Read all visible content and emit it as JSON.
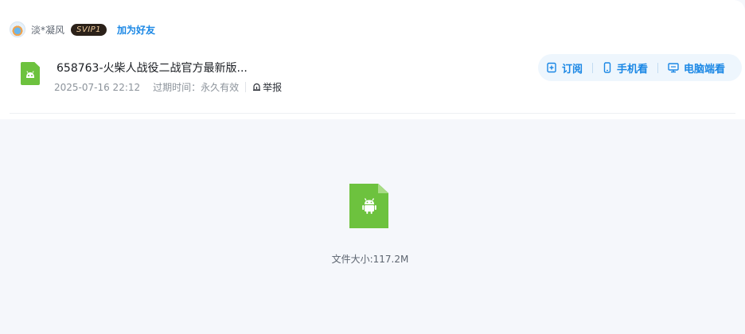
{
  "header": {
    "username": "淡*凝风",
    "badge": "SVIP1",
    "add_friend": "加为好友"
  },
  "file": {
    "title": "658763-火柴人战役二战官方最新版...",
    "date": "2025-07-16 22:12",
    "expiry": "过期时间：永久有效",
    "report": "举报",
    "icon": "android-apk-icon"
  },
  "actions": [
    {
      "label": "订阅",
      "icon": "subscribe-icon"
    },
    {
      "label": "手机看",
      "icon": "phone-icon"
    },
    {
      "label": "电脑端看",
      "icon": "desktop-icon"
    }
  ],
  "preview": {
    "size_text": "文件大小:117.2M"
  },
  "colors": {
    "accent": "#1a87e5",
    "apk_green": "#6dc23e",
    "badge_bg": "#2b2119"
  }
}
